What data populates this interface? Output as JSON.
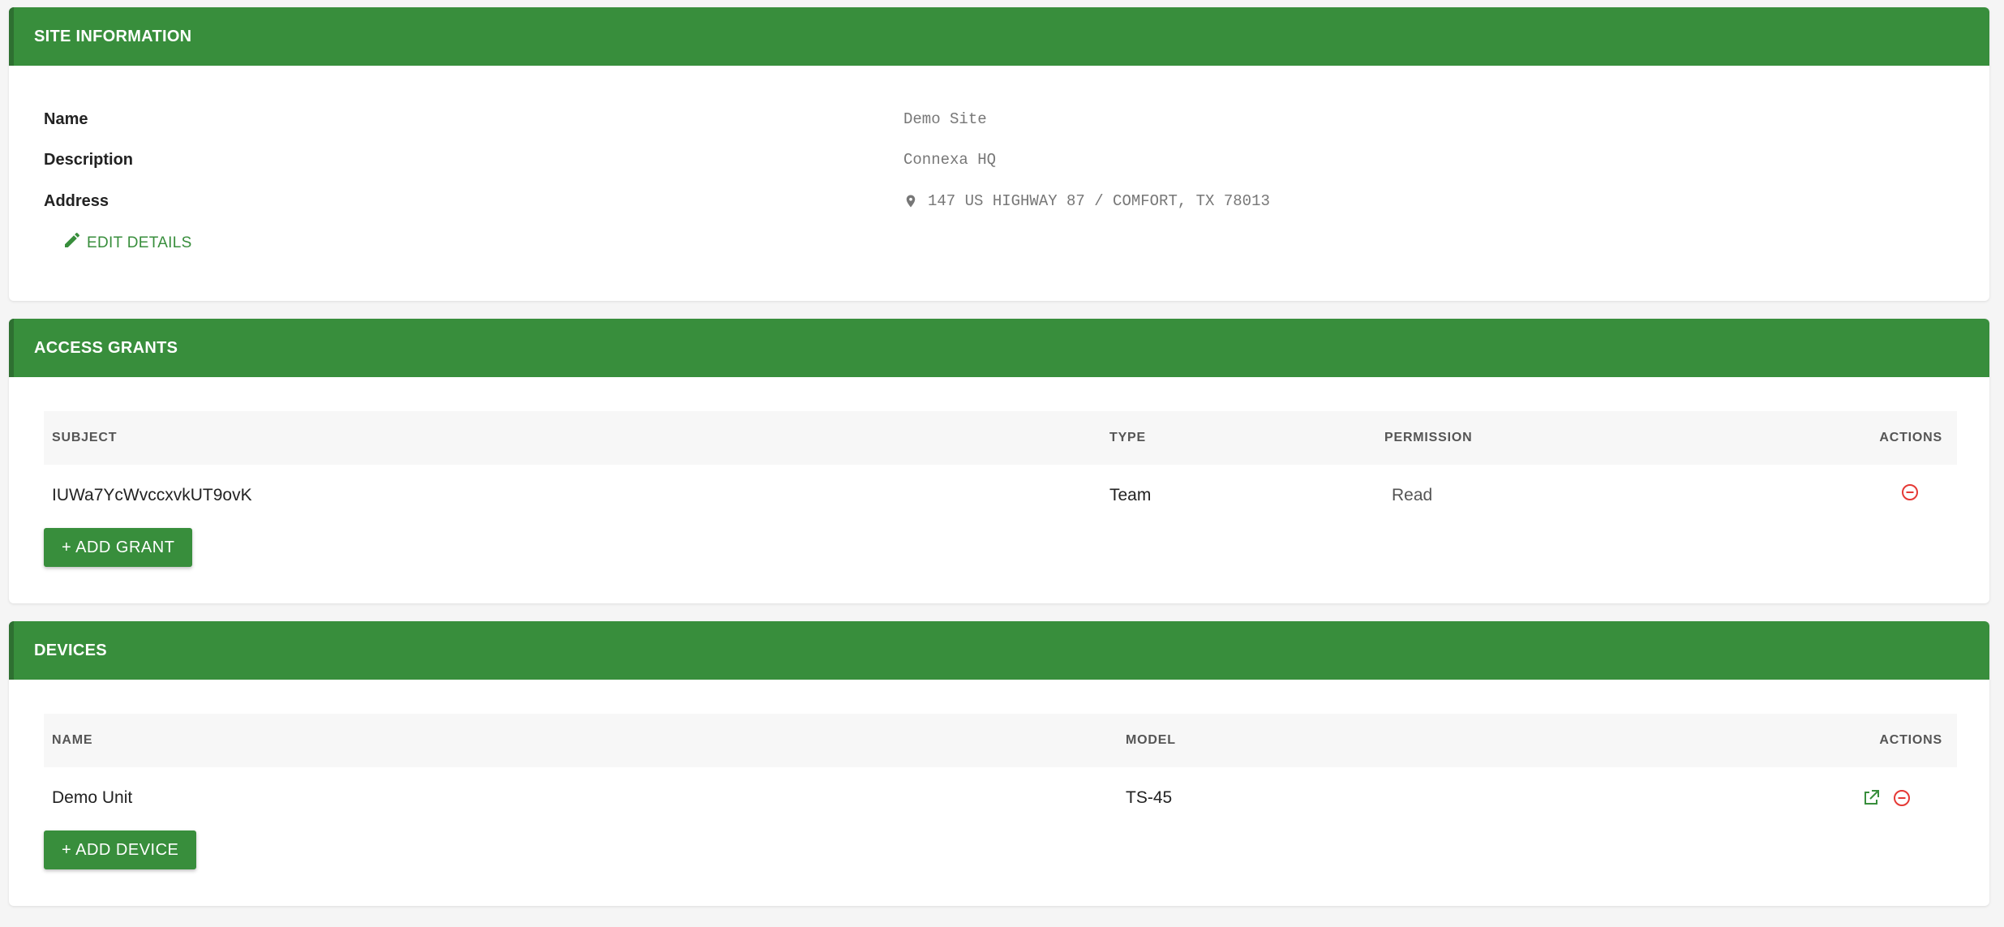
{
  "site_info": {
    "header": "SITE INFORMATION",
    "fields": [
      {
        "label": "Name",
        "value": "Demo Site"
      },
      {
        "label": "Description",
        "value": "Connexa HQ"
      },
      {
        "label": "Address",
        "value": "147 US HIGHWAY 87 / COMFORT, TX 78013"
      }
    ],
    "edit_label": "EDIT DETAILS"
  },
  "access_grants": {
    "header": "ACCESS GRANTS",
    "columns": {
      "subject": "SUBJECT",
      "type": "TYPE",
      "permission": "PERMISSION",
      "actions": "ACTIONS"
    },
    "rows": [
      {
        "subject": "IUWa7YcWvccxvkUT9ovK",
        "type": "Team",
        "permission": "Read"
      }
    ],
    "add_label": "+ ADD GRANT"
  },
  "devices": {
    "header": "DEVICES",
    "columns": {
      "name": "NAME",
      "model": "MODEL",
      "actions": "ACTIONS"
    },
    "rows": [
      {
        "name": "Demo Unit",
        "model": "TS-45"
      }
    ],
    "add_label": "+ ADD DEVICE"
  },
  "icons": {
    "address": "map-pin-icon",
    "edit": "pencil-icon",
    "remove": "remove-circle-icon",
    "open": "open-external-icon"
  },
  "colors": {
    "brand": "#388e3c",
    "danger": "#e53935"
  }
}
